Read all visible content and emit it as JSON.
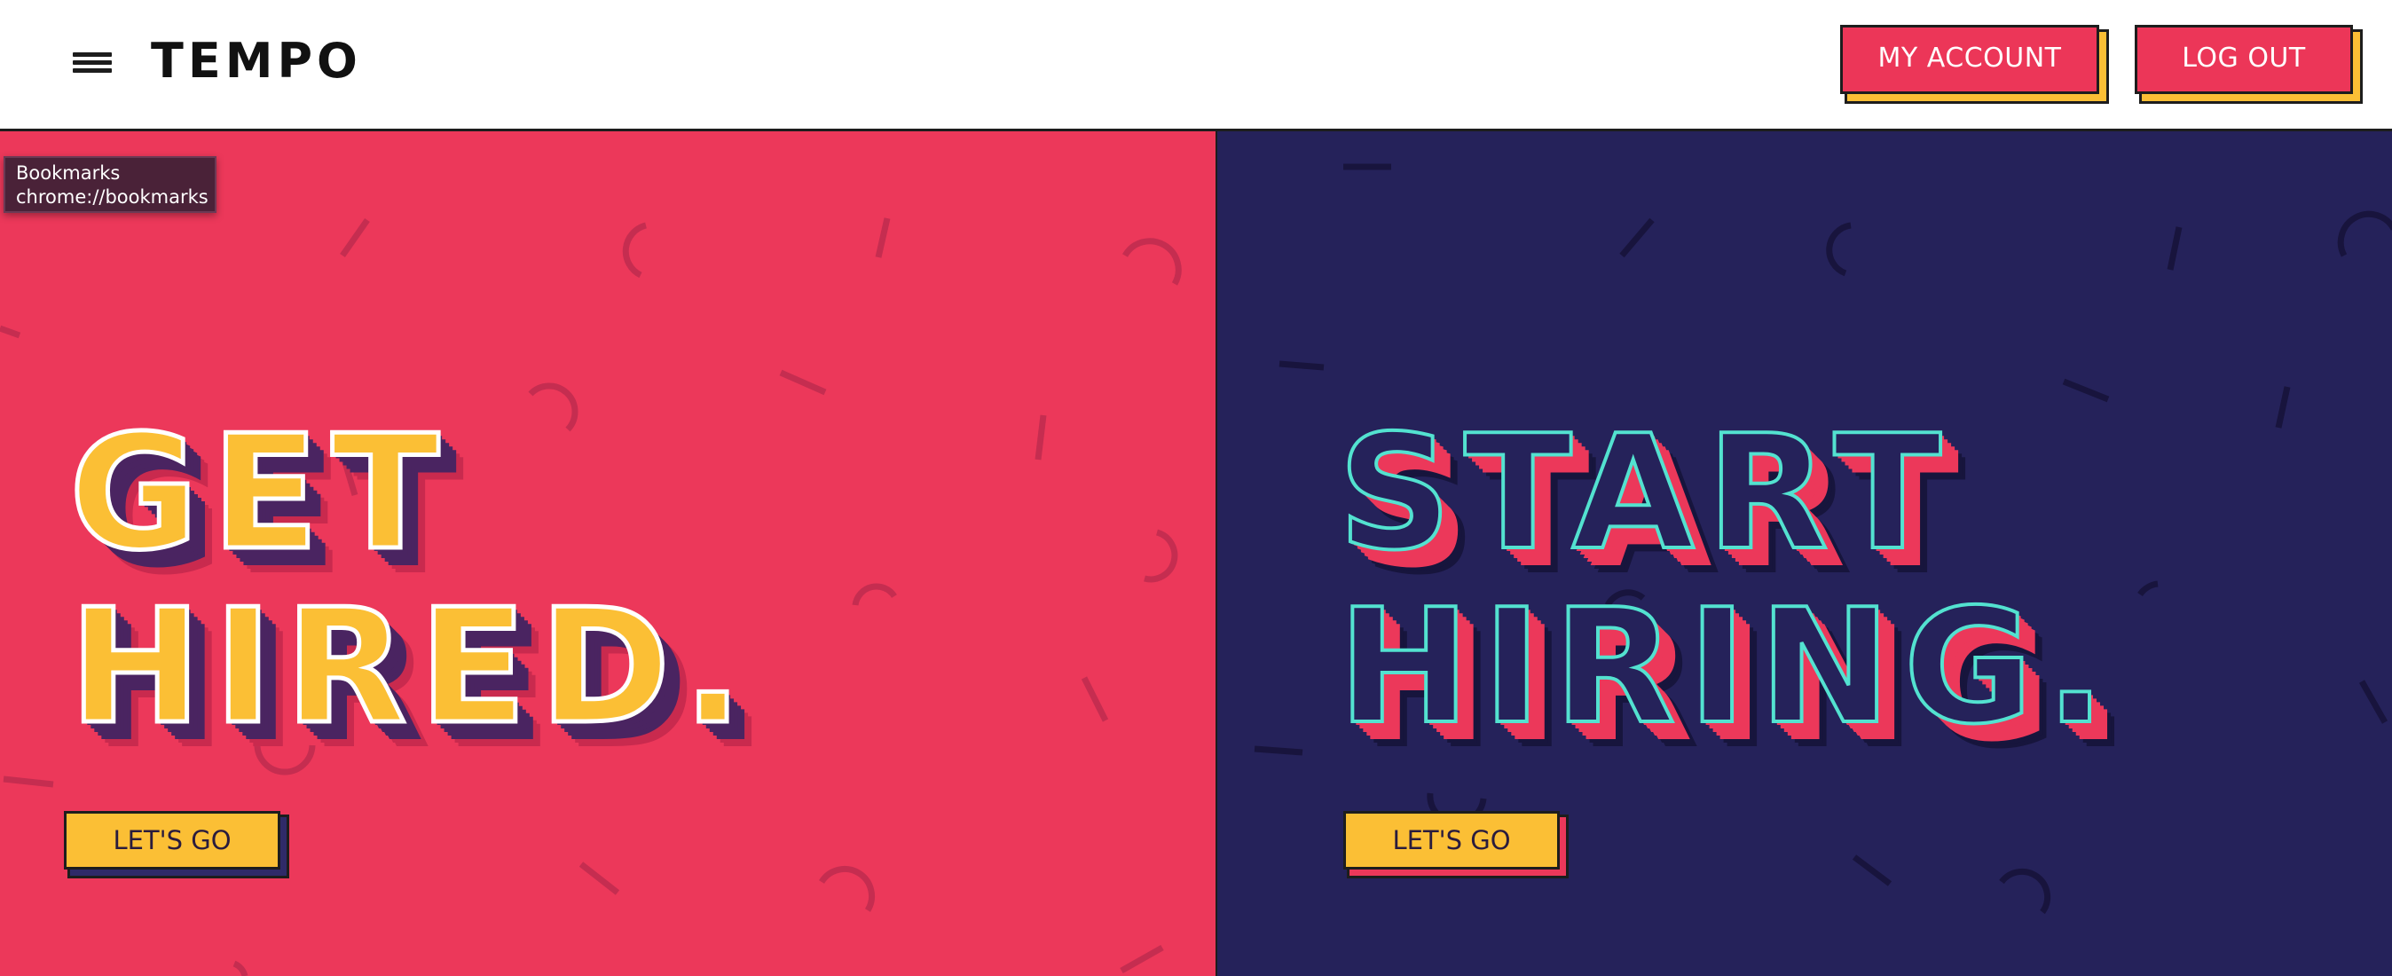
{
  "header": {
    "logo": "TEMPO",
    "my_account_label": "MY ACCOUNT",
    "log_out_label": "LOG OUT"
  },
  "tooltip": {
    "title": "Bookmarks",
    "url": "chrome://bookmarks"
  },
  "left_panel": {
    "headline_line1": "GET",
    "headline_line2": "HIRED.",
    "cta_label": "LET'S GO"
  },
  "right_panel": {
    "headline_line1": "START",
    "headline_line2": "HIRING.",
    "cta_label": "LET'S GO"
  },
  "colors": {
    "brand_pink": "#ec385a",
    "brand_navy": "#25225a",
    "accent_yellow": "#fbbf35",
    "accent_teal": "#53e2d0"
  },
  "icons": {
    "menu": "hamburger-menu-icon"
  }
}
